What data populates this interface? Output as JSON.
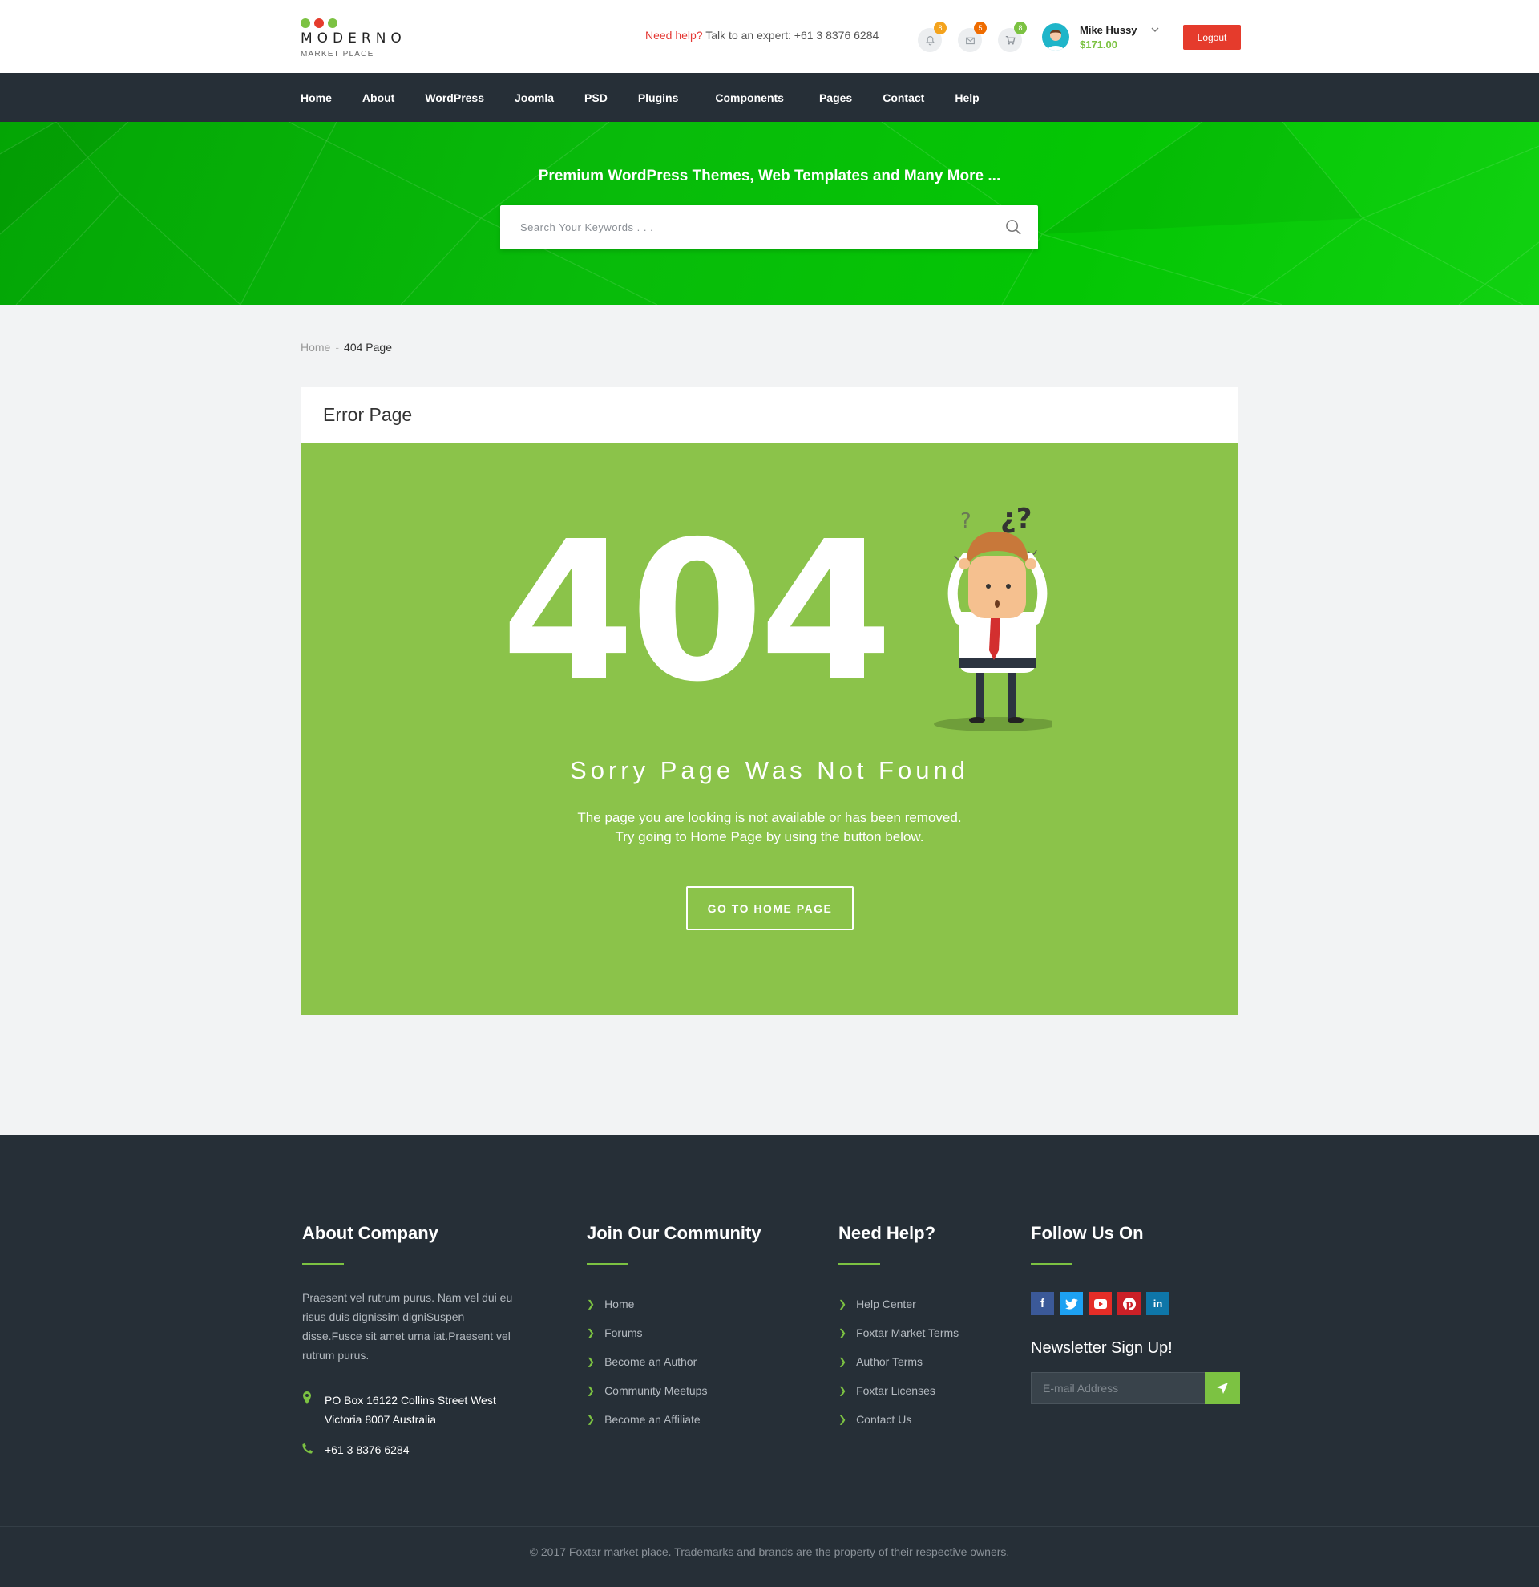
{
  "header": {
    "logo": {
      "name": "MODERNO",
      "tagline": "MARKET PLACE",
      "dot_colors": [
        "#7cc242",
        "#e53b2c",
        "#7cc242"
      ]
    },
    "help_label": "Need help?",
    "help_text": "Talk to an expert: +61 3 8376 6284",
    "notifications": {
      "count": "8",
      "color": "#f4a31d"
    },
    "messages": {
      "count": "5",
      "color": "#ef6c00"
    },
    "cart": {
      "count": "8",
      "color": "#7cc242"
    },
    "user": {
      "name": "Mike Hussy",
      "balance": "$171.00"
    },
    "logout_label": "Logout"
  },
  "nav": {
    "items": [
      "Home",
      "About",
      "WordPress",
      "Joomla",
      "PSD",
      "Plugins",
      "Components",
      "Pages",
      "Contact",
      "Help"
    ]
  },
  "hero": {
    "title": "Premium WordPress Themes, Web Templates and Many More ...",
    "search_placeholder": "Search Your Keywords . . ."
  },
  "breadcrumb": {
    "home": "Home",
    "separator": "-",
    "current": "404 Page"
  },
  "error_card": {
    "title": "Error Page",
    "code": "404",
    "heading": "Sorry Page Was Not Found",
    "line1": "The page you are looking is not available or has been removed.",
    "line2": "Try going to Home Page by using the button below.",
    "button_label": "GO TO HOME PAGE",
    "bg_color": "#8bc34a"
  },
  "footer": {
    "about": {
      "title": "About Company",
      "text": "Praesent vel rutrum purus. Nam vel dui eu risus duis dignissim digniSuspen disse.Fusce sit amet urna iat.Praesent vel rutrum purus.",
      "address_line1": "PO Box 16122 Collins Street West",
      "address_line2": "Victoria 8007 Australia",
      "phone": "+61 3 8376 6284"
    },
    "community": {
      "title": "Join Our Community",
      "links": [
        "Home",
        "Forums",
        "Become an Author",
        "Community Meetups",
        "Become an Affiliate"
      ]
    },
    "help": {
      "title": "Need Help?",
      "links": [
        "Help Center",
        "Foxtar Market Terms",
        "Author Terms",
        "Foxtar Licenses",
        "Contact Us"
      ]
    },
    "follow": {
      "title": "Follow Us On",
      "networks": [
        "facebook-icon",
        "twitter-icon",
        "youtube-icon",
        "pinterest-icon",
        "linkedin-icon"
      ],
      "newsletter_title": "Newsletter Sign Up!",
      "email_placeholder": "E-mail Address"
    },
    "copyright": "© 2017 Foxtar market place. Trademarks and brands are the property of their respective owners."
  }
}
